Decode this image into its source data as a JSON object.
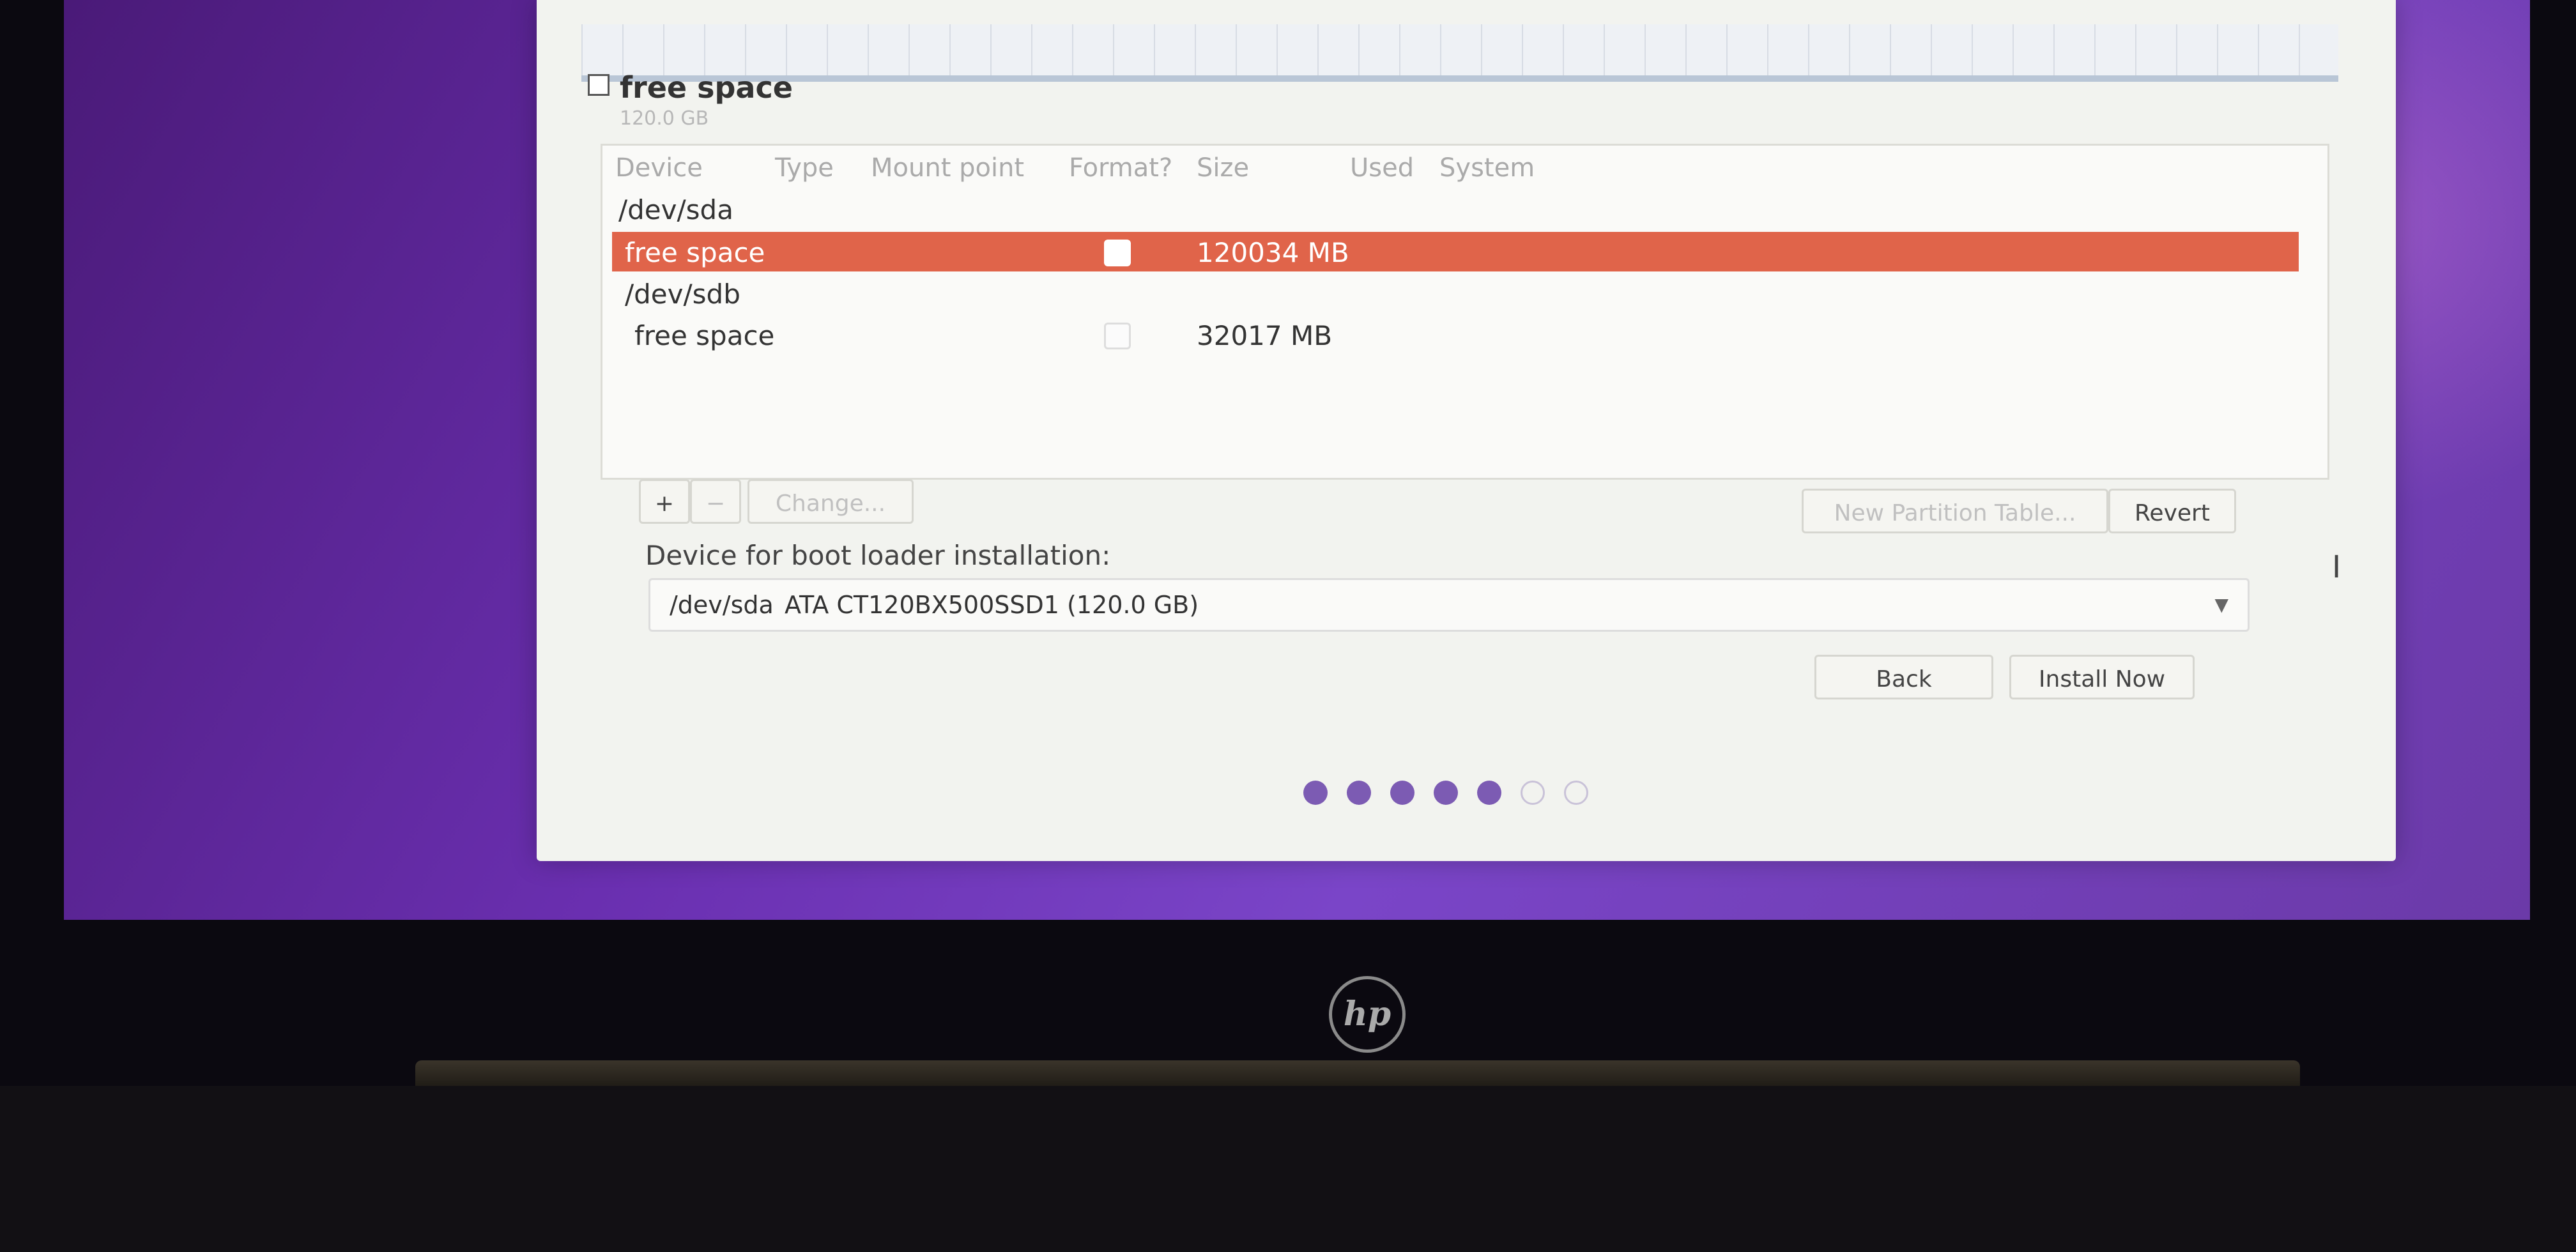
{
  "installer": {
    "legend": {
      "name": "free space",
      "size": "120.0 GB"
    },
    "table": {
      "headers": [
        "Device",
        "Type",
        "Mount point",
        "Format?",
        "Size",
        "Used",
        "System"
      ],
      "rows": [
        {
          "device": "/dev/sda",
          "size": ""
        },
        {
          "device": "free space",
          "size": "120034 MB",
          "selected": true
        },
        {
          "device": "/dev/sdb",
          "size": ""
        },
        {
          "device": "free space",
          "size": "32017 MB"
        }
      ]
    },
    "toolbar": {
      "add_label": "+",
      "remove_label": "−",
      "change_label": "Change...",
      "new_partition_table_label": "New Partition Table...",
      "revert_label": "Revert"
    },
    "boot_loader": {
      "label": "Device for boot loader installation:",
      "device": "/dev/sda",
      "description": "ATA CT120BX500SSD1 (120.0 GB)"
    },
    "nav": {
      "back_label": "Back",
      "install_label": "Install Now"
    },
    "progress": {
      "total_steps": 7,
      "completed_steps": 5
    },
    "colors": {
      "selected_row": "#e0644a",
      "desktop": "#6a2fb0",
      "dot": "#7c5bb3"
    }
  },
  "laptop": {
    "brand": "hp"
  }
}
